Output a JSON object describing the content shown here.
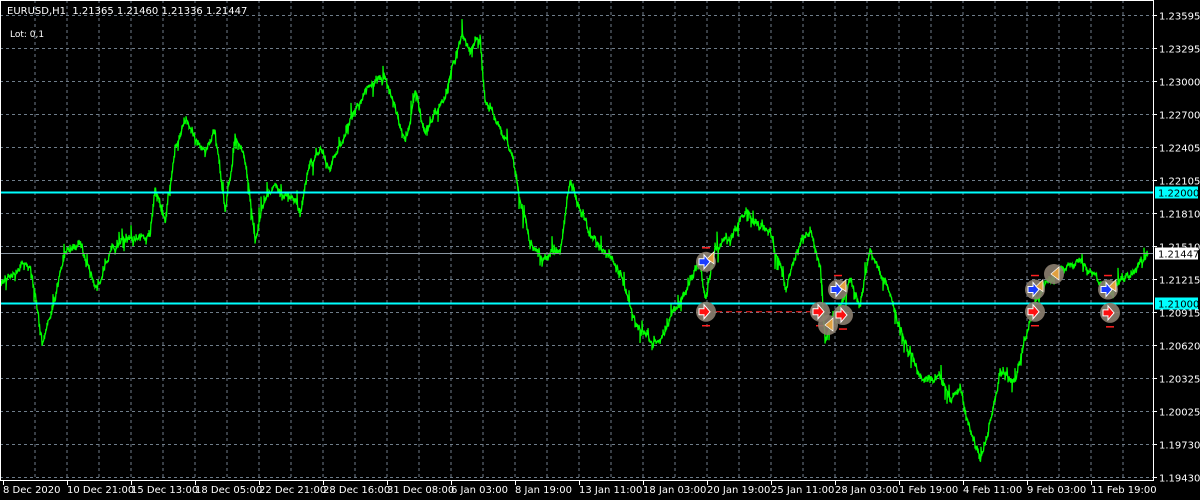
{
  "header": {
    "symbol": "EURUSD,H1",
    "ohlc": "1.21365 1.21460 1.21336 1.21447",
    "lot_label": "Lot: 0,1"
  },
  "colors": {
    "background": "#000000",
    "price_line": "#00ff00",
    "level_line": "#00ffff",
    "grid": "#6f7d8a",
    "axis_text": "#ffffff",
    "current_price_line": "#8a96a2"
  },
  "price_axis": {
    "labels": [
      "1.23595",
      "1.23295",
      "1.23000",
      "1.22700",
      "1.22405",
      "1.22105",
      "1.21810",
      "1.21510",
      "1.21215",
      "1.20915",
      "1.20620",
      "1.20325",
      "1.20025",
      "1.19730",
      "1.19430"
    ],
    "range": [
      1.1943,
      1.23595
    ]
  },
  "levels": [
    {
      "price": 1.22,
      "label": "1.22000"
    },
    {
      "price": 1.21,
      "label": "1.21000"
    }
  ],
  "current_price": {
    "price": 1.21447,
    "label": "1.21447"
  },
  "time_axis": {
    "labels": [
      "8 Dec 2020",
      "10 Dec 21:00",
      "15 Dec 13:00",
      "18 Dec 05:00",
      "22 Dec 21:00",
      "28 Dec 16:00",
      "31 Dec 08:00",
      "6 Jan 03:00",
      "8 Jan 19:00",
      "13 Jan 11:00",
      "18 Jan 03:00",
      "20 Jan 19:00",
      "25 Jan 11:00",
      "28 Jan 03:00",
      "1 Feb 19:00",
      "4 Feb 11:00",
      "9 Feb 03:00",
      "11 Feb 19:00"
    ]
  },
  "series": {
    "bars_total": 1153,
    "keypoints": [
      [
        0,
        1.212
      ],
      [
        15,
        1.2129
      ],
      [
        30,
        1.2138
      ],
      [
        42,
        1.2062
      ],
      [
        55,
        1.2102
      ],
      [
        65,
        1.2148
      ],
      [
        80,
        1.2157
      ],
      [
        95,
        1.2111
      ],
      [
        110,
        1.2148
      ],
      [
        130,
        1.2157
      ],
      [
        150,
        1.2161
      ],
      [
        155,
        1.2202
      ],
      [
        165,
        1.2175
      ],
      [
        175,
        1.2238
      ],
      [
        185,
        1.2269
      ],
      [
        195,
        1.2247
      ],
      [
        205,
        1.2238
      ],
      [
        215,
        1.2256
      ],
      [
        225,
        1.2184
      ],
      [
        235,
        1.2247
      ],
      [
        245,
        1.2229
      ],
      [
        255,
        1.2157
      ],
      [
        265,
        1.2193
      ],
      [
        275,
        1.2202
      ],
      [
        290,
        1.2193
      ],
      [
        300,
        1.2184
      ],
      [
        310,
        1.2229
      ],
      [
        320,
        1.2238
      ],
      [
        330,
        1.222
      ],
      [
        345,
        1.2256
      ],
      [
        360,
        1.2283
      ],
      [
        375,
        1.2301
      ],
      [
        385,
        1.2301
      ],
      [
        395,
        1.2274
      ],
      [
        405,
        1.2247
      ],
      [
        415,
        1.2287
      ],
      [
        425,
        1.2251
      ],
      [
        435,
        1.2274
      ],
      [
        445,
        1.2283
      ],
      [
        455,
        1.2319
      ],
      [
        462,
        1.2346
      ],
      [
        470,
        1.2328
      ],
      [
        480,
        1.2337
      ],
      [
        485,
        1.2283
      ],
      [
        495,
        1.2265
      ],
      [
        510,
        1.2238
      ],
      [
        520,
        1.2193
      ],
      [
        530,
        1.2157
      ],
      [
        545,
        1.2138
      ],
      [
        560,
        1.2148
      ],
      [
        570,
        1.2215
      ],
      [
        580,
        1.2184
      ],
      [
        590,
        1.2157
      ],
      [
        605,
        1.2148
      ],
      [
        620,
        1.2129
      ],
      [
        635,
        1.2084
      ],
      [
        650,
        1.2062
      ],
      [
        665,
        1.2075
      ],
      [
        680,
        1.2102
      ],
      [
        690,
        1.212
      ],
      [
        700,
        1.2138
      ],
      [
        705,
        1.2102
      ],
      [
        715,
        1.2148
      ],
      [
        730,
        1.2157
      ],
      [
        745,
        1.2184
      ],
      [
        760,
        1.217
      ],
      [
        770,
        1.2166
      ],
      [
        785,
        1.2111
      ],
      [
        800,
        1.2157
      ],
      [
        810,
        1.2166
      ],
      [
        820,
        1.2138
      ],
      [
        825,
        1.2066
      ],
      [
        840,
        1.2102
      ],
      [
        850,
        1.212
      ],
      [
        860,
        1.2102
      ],
      [
        870,
        1.2148
      ],
      [
        885,
        1.212
      ],
      [
        900,
        1.2075
      ],
      [
        915,
        1.2048
      ],
      [
        925,
        1.203
      ],
      [
        940,
        1.2035
      ],
      [
        950,
        1.2012
      ],
      [
        960,
        1.2021
      ],
      [
        970,
        1.1985
      ],
      [
        980,
        1.1958
      ],
      [
        990,
        1.1994
      ],
      [
        1000,
        1.2039
      ],
      [
        1015,
        1.203
      ],
      [
        1025,
        1.2066
      ],
      [
        1035,
        1.2102
      ],
      [
        1050,
        1.212
      ],
      [
        1065,
        1.2129
      ],
      [
        1080,
        1.2138
      ],
      [
        1095,
        1.212
      ],
      [
        1110,
        1.2111
      ],
      [
        1120,
        1.212
      ],
      [
        1135,
        1.2129
      ],
      [
        1148,
        1.21447
      ]
    ]
  },
  "trades": [
    {
      "bar": 706,
      "price": 1.2137,
      "type": "buy"
    },
    {
      "bar": 706,
      "price": 1.2092,
      "type": "sell"
    },
    {
      "bar": 820,
      "price": 1.2092,
      "type": "sell"
    },
    {
      "bar": 838,
      "price": 1.2112,
      "type": "buy"
    },
    {
      "bar": 843,
      "price": 1.2089,
      "type": "sell"
    },
    {
      "bar": 828,
      "price": 1.208,
      "type": "close"
    },
    {
      "bar": 1035,
      "price": 1.2112,
      "type": "buy"
    },
    {
      "bar": 1054,
      "price": 1.2126,
      "type": "close"
    },
    {
      "bar": 1035,
      "price": 1.2092,
      "type": "sell"
    },
    {
      "bar": 1108,
      "price": 1.2112,
      "type": "buy"
    },
    {
      "bar": 1110,
      "price": 1.2091,
      "type": "sell"
    }
  ]
}
